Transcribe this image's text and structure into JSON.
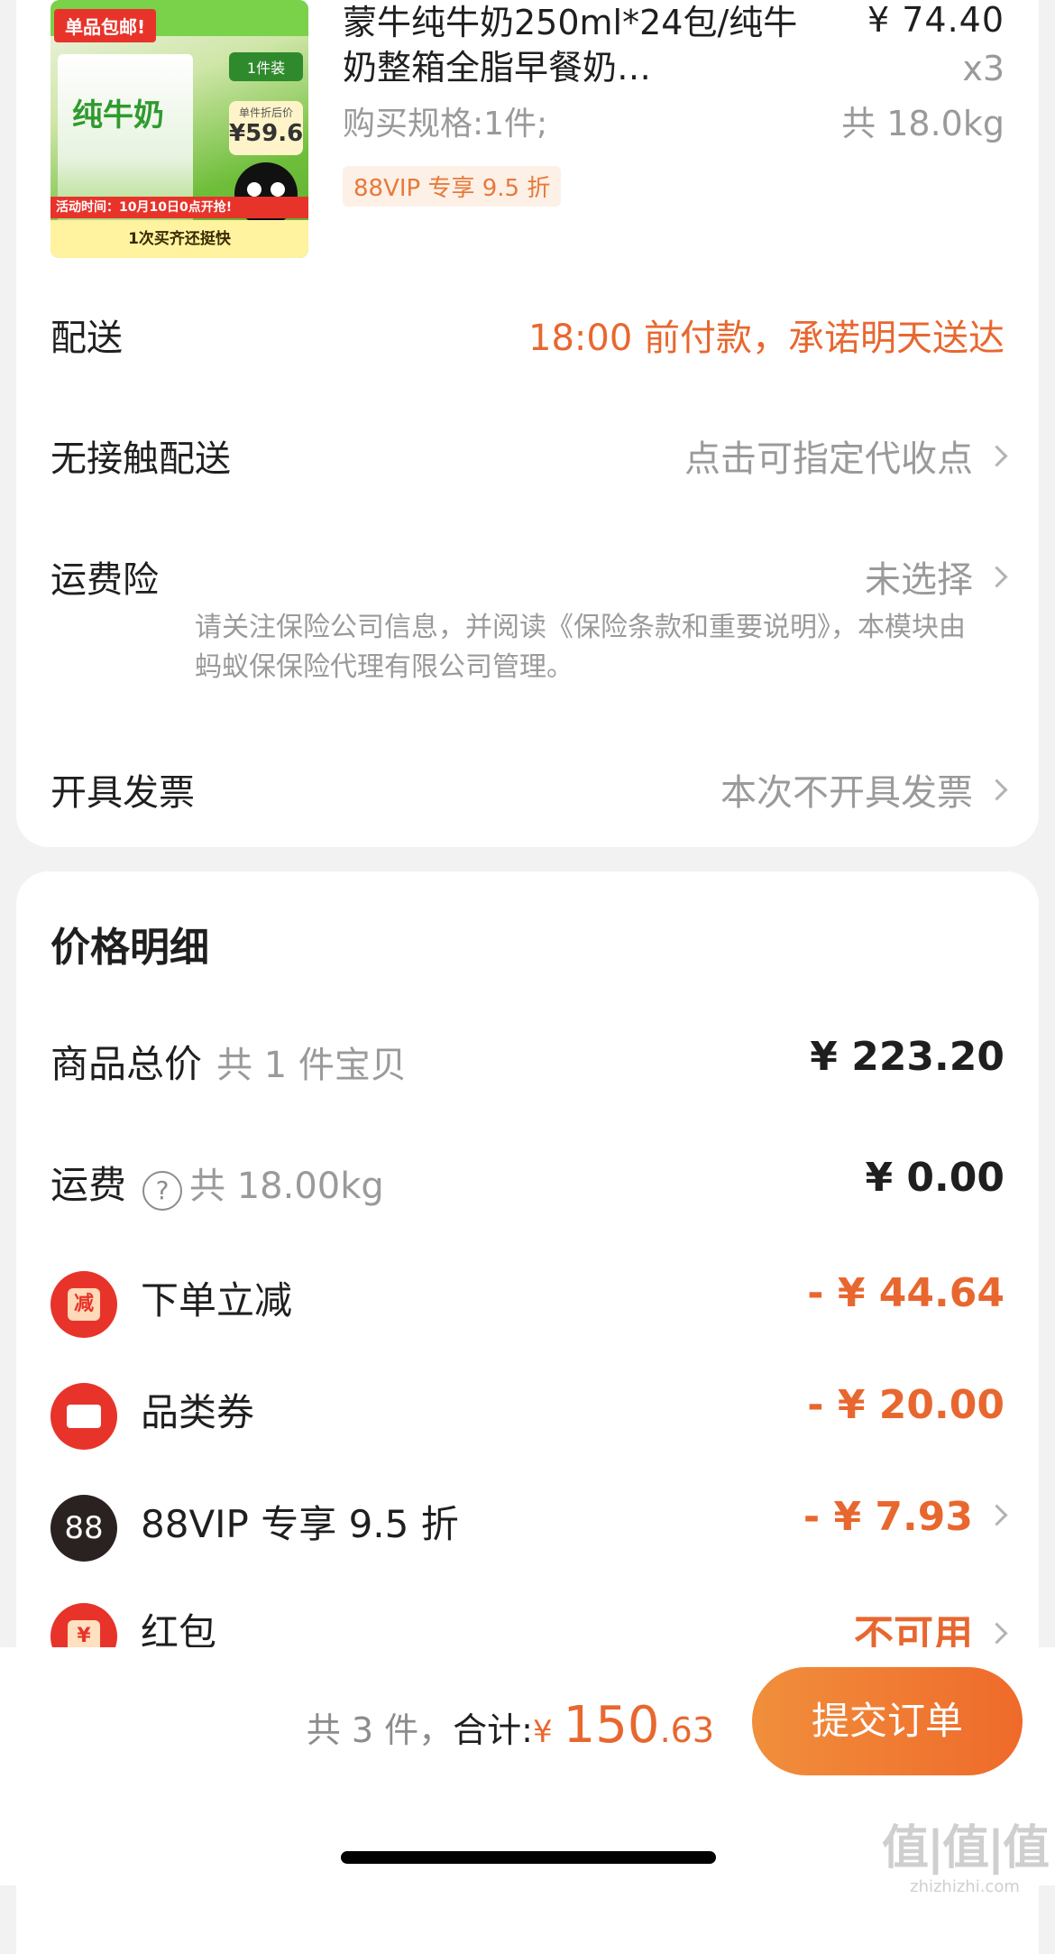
{
  "product": {
    "thumb": {
      "tag": "单品包邮!",
      "box_title": "纯牛奶",
      "pack_tag": "1件装",
      "unit_label": "单件折后价",
      "unit_price": "¥59.6",
      "activity": "活动时间：10月10日0点开抢!",
      "footer": "1次买齐还挺快"
    },
    "title": "蒙牛纯牛奶250ml*24包/纯牛奶整箱全脂早餐奶…",
    "price": "¥ 74.40",
    "qty": "x3",
    "weight": "共 18.0kg",
    "spec": "购买规格:1件;",
    "vip_badge": "88VIP 专享 9.5 折"
  },
  "delivery": {
    "label": "配送",
    "value": "18:00 前付款，承诺明天送达"
  },
  "contactless": {
    "label": "无接触配送",
    "value": "点击可指定代收点"
  },
  "shipping_insurance": {
    "label": "运费险",
    "value": "未选择",
    "note": "请关注保险公司信息，并阅读《保险条款和重要说明》，本模块由蚂蚁保保险代理有限公司管理。"
  },
  "invoice": {
    "label": "开具发票",
    "value": "本次不开具发票"
  },
  "price_detail": {
    "title": "价格明细",
    "goods_total": {
      "label": "商品总价",
      "sub": "共 1 件宝贝",
      "amount": "¥ 223.20"
    },
    "freight": {
      "label": "运费",
      "help_icon": "?",
      "sub": "共 18.00kg",
      "amount": "¥ 0.00"
    },
    "discount_order": {
      "icon_text": "减",
      "label": "下单立减",
      "amount": "- ¥ 44.64"
    },
    "category_coupon": {
      "label": "品类券",
      "amount": "- ¥ 20.00"
    },
    "vip_discount": {
      "icon_text": "88",
      "label": "88VIP 专享 9.5 折",
      "amount": "- ¥ 7.93"
    },
    "red_packet": {
      "label": "红包",
      "amount": "不可用"
    }
  },
  "footer": {
    "count": "共 3 件，",
    "total_label": "合计:",
    "currency": "¥",
    "total_int": "150",
    "total_dec": ".63",
    "submit": "提交订单"
  },
  "watermark": {
    "big": "值|值|值",
    "small": "zhizhizhi.com"
  },
  "colors": {
    "accent": "#e8672f",
    "gray": "#9a9a9a",
    "submit_from": "#f08f3c",
    "submit_to": "#ef6a2a"
  }
}
